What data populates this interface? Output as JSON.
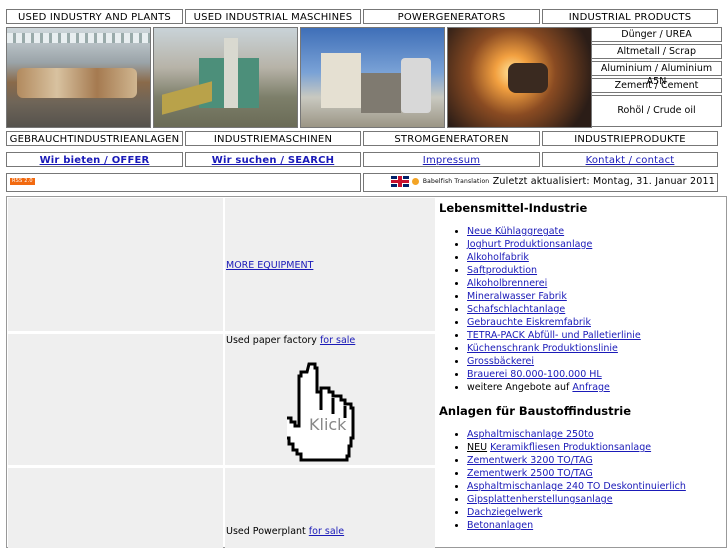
{
  "top_nav": [
    "USED INDUSTRY AND PLANTS",
    "USED INDUSTRIAL MASCHINES",
    "POWERGENERATORS",
    "INDUSTRIAL PRODUCTS"
  ],
  "side_products": [
    "Dünger / UREA",
    "Altmetall / Scrap",
    "Aluminium / Aluminium A5N",
    "Zement / Cement",
    "Rohöl / Crude oil"
  ],
  "de_nav": [
    "GEBRAUCHTINDUSTRIEANLAGEN",
    "INDUSTRIEMASCHINEN",
    "STROMGENERATOREN",
    "INDUSTRIEPRODUKTE"
  ],
  "link_nav": [
    "Wir bieten / OFFER",
    "Wir suchen / SEARCH",
    "Impressum",
    "Kontakt / contact"
  ],
  "status": {
    "rss_label": "RSS 2.0",
    "babelfish_label": "Babelfish Translation",
    "updated": "Zuletzt aktualisiert: Montag, 31. Januar 2011"
  },
  "left": {
    "more_equipment": "MORE EQUIPMENT",
    "paper_factory_text": "Used paper factory ",
    "paper_factory_link": "for sale",
    "klick_label": "Klick",
    "powerplant_text": "Used Powerplant ",
    "powerplant_link": "for sale"
  },
  "section1": {
    "title": "Lebensmittel-Industrie",
    "items": [
      "Neue Kühlaggregate ",
      "Joghurt Produktionsanlage ",
      "Alkoholfabrik ",
      "Saftproduktion ",
      "Alkoholbrennerei ",
      "Mineralwasser Fabrik ",
      "Schafschlachtanlage ",
      "Gebrauchte Eiskremfabrik ",
      "TETRA-PACK Abfüll- und Palletierlinie ",
      "Küchenschrank Produktionslinie",
      "Grossbäckerei",
      "Brauerei 80.000-100.000 HL"
    ],
    "more_prefix": "weitere Angebote auf ",
    "more_link": "Anfrage"
  },
  "section2": {
    "title": "Anlagen für Baustoffindustrie",
    "items": [
      "Asphaltmischanlage 250to",
      "Keramikfliesen Produktionsanlage",
      "Zementwerk 3200 TO/TAG ",
      "Zementwerk 2500 TO/TAG ",
      "Asphaltmischanlage 240 TO Deskontinuierlich ",
      "Gipsplattenherstellungsanlage ",
      "Dachziegelwerk ",
      "Betonanlagen"
    ],
    "neu_label": "NEU"
  }
}
